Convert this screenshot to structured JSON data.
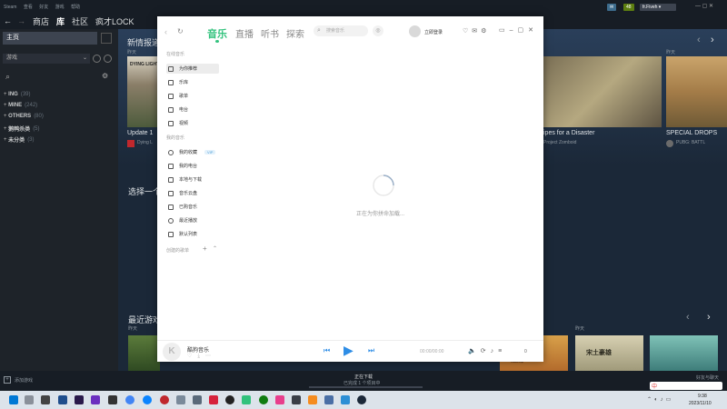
{
  "steam": {
    "menu": [
      "Steam",
      "查看",
      "好友",
      "游戏",
      "帮助"
    ],
    "nav": {
      "store": "商店",
      "library": "库",
      "community": "社区",
      "username": "疯才LOCK"
    },
    "status_pills": [
      "✉",
      "48",
      "fr.Fiveh ▾"
    ],
    "sidebar": {
      "home_label": "主页",
      "filter_label": "游戏",
      "categories": [
        {
          "name": "ING",
          "count": "(39)"
        },
        {
          "name": "MINE",
          "count": "(242)"
        },
        {
          "name": "OTHERS",
          "count": "(80)"
        },
        {
          "name": "鹅鸭杀类",
          "count": "(5)"
        },
        {
          "name": "未分类",
          "count": "(3)"
        }
      ],
      "add_game_label": "添加游戏"
    },
    "main": {
      "whats_new": "新情报道",
      "whats_new_caption_left": "昨天",
      "whats_new_caption_right": "昨天",
      "select_prefix": "选择一个",
      "recent_games": "最近游戏",
      "recent_caption": "昨天",
      "cards": [
        {
          "title": "Update 1",
          "sub": "Dying L",
          "logo": "DYING LIGHT"
        },
        {
          "title": "ipes for a Disaster",
          "sub": "Project Zomboid"
        },
        {
          "title": "SPECIAL DROPS",
          "sub": "PUBG: BATTL"
        }
      ],
      "recent_caption_2": "昨天",
      "recent_game_title": "江湖 ♥",
      "recent_game_title2": "宋土豪雄"
    },
    "downloads": {
      "title": "正在下载",
      "subtitle": "已完成 1 个项目中"
    },
    "friends_label": "好友与聊天"
  },
  "music_app": {
    "tabs": [
      "音乐",
      "直播",
      "听书",
      "探索"
    ],
    "search_placeholder": "搜索音乐",
    "login_label": "立即登录",
    "online_group": "在线音乐",
    "online_items": [
      "为你推荐",
      "乐库",
      "歌单",
      "电台",
      "视频"
    ],
    "my_group": "我的音乐",
    "my_items": [
      "我的收藏",
      "我的电台",
      "本地与下载",
      "音乐云盘",
      "已购音乐",
      "最近播放",
      "默认列表"
    ],
    "vip_badge": "VIP",
    "created_group": "创建的歌单",
    "loading_text": "正在为你拼命加载...",
    "player": {
      "song": "酷狗音乐",
      "time": "00:00/00:00",
      "queue_count": "0"
    }
  },
  "taskbar": {
    "time": "9:38",
    "date": "2023/11/10",
    "lang": "中"
  }
}
